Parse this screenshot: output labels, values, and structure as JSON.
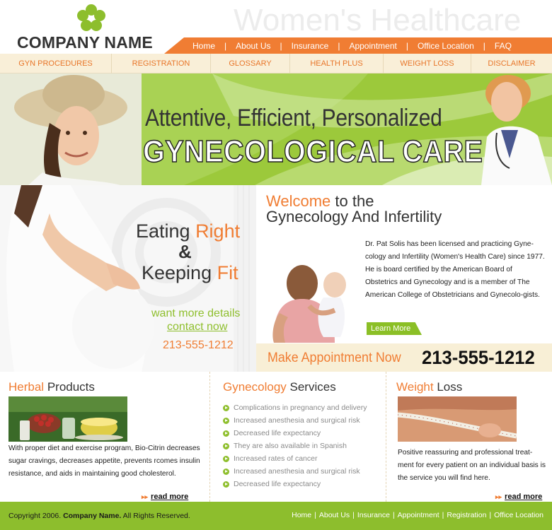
{
  "header": {
    "company_name": "COMPANY NAME",
    "site_title": "Women's Healthcare"
  },
  "top_nav": [
    "Home",
    "About Us",
    "Insurance",
    "Appointment",
    "Office Location",
    "FAQ"
  ],
  "sub_nav": [
    "GYN PROCEDURES",
    "REGISTRATION",
    "GLOSSARY",
    "HEALTH PLUS",
    "WEIGHT LOSS",
    "DISCLAIMER"
  ],
  "banner": {
    "line1": "Attentive, Efficient, Personalized",
    "line2": "GYNECOLOGICAL CARE"
  },
  "promo": {
    "eating": "Eating ",
    "right": "Right",
    "amp": "&",
    "keeping": "Keeping ",
    "fit": "Fit",
    "want_more": "want more details",
    "contact_now": "contact now",
    "phone": "213-555-1212"
  },
  "welcome": {
    "title_accent": "Welcome",
    "title_rest": " to the",
    "title_line2": "Gynecology And Infertility",
    "text": "Dr. Pat Solis has been licensed and practicing Gyne-cology and Infertility (Women's Health Care) since 1977. He is board certified by the American Board of Obstetrics and Gynecology and is a member of The American College of Obstetricians and Gynecolo-gists.",
    "learn_more": "Learn More"
  },
  "appointment": {
    "label": "Make Appointment Now",
    "phone": "213-555-1212"
  },
  "herbal": {
    "title_accent": "Herbal",
    "title_rest": " Products",
    "text": "With proper diet and exercise program, Bio-Citrin decreases sugar cravings, decreases appetite, prevents rcomes insulin resistance, and aids in maintaining good cholesterol.",
    "read_more": "read more"
  },
  "services": {
    "title_accent": "Gynecology",
    "title_rest": " Services",
    "items": [
      "Complications in pregnancy and delivery",
      "Increased anesthesia and surgical risk",
      "Decreased life expectancy",
      "They are also available in Spanish",
      "Increased rates of cancer",
      "Increased anesthesia and surgical risk",
      "Decreased life expectancy"
    ]
  },
  "weight_loss": {
    "title_accent": "Weight",
    "title_rest": " Loss",
    "text": "Positive reassuring and professional treat-ment for every patient on an individual basis is the service you will find here.",
    "read_more": "read more"
  },
  "footer": {
    "copyright_prefix": "Copyright 2006. ",
    "company": "Company Name.",
    "copyright_suffix": " All Rights Reserved.",
    "nav": [
      "Home",
      "About Us",
      "Insurance",
      "Appointment",
      "Registration",
      "Office Location"
    ]
  },
  "colors": {
    "accent_orange": "#f07d33",
    "accent_green": "#8dbe2d",
    "subnav_bg": "#f9efd8"
  }
}
